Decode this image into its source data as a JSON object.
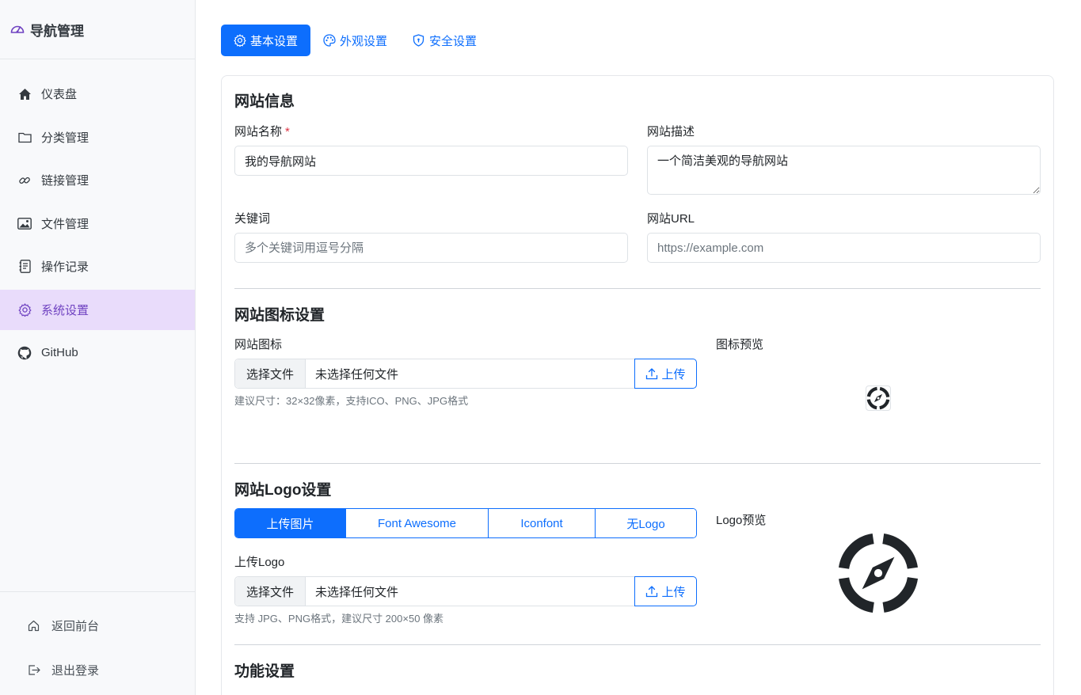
{
  "brand": {
    "title": "导航管理",
    "icon": "gauge-icon"
  },
  "sidebar": {
    "items": [
      {
        "label": "仪表盘",
        "icon": "house-icon"
      },
      {
        "label": "分类管理",
        "icon": "folder-icon"
      },
      {
        "label": "链接管理",
        "icon": "link-icon"
      },
      {
        "label": "文件管理",
        "icon": "image-icon"
      },
      {
        "label": "操作记录",
        "icon": "journal-icon"
      },
      {
        "label": "系统设置",
        "icon": "gear-icon",
        "active": true
      },
      {
        "label": "GitHub",
        "icon": "github-icon"
      }
    ],
    "bottom": [
      {
        "label": "返回前台",
        "icon": "home-outline-icon"
      },
      {
        "label": "退出登录",
        "icon": "logout-icon"
      }
    ]
  },
  "tabs": [
    {
      "label": "基本设置",
      "icon": "gear-icon",
      "active": true
    },
    {
      "label": "外观设置",
      "icon": "palette-icon"
    },
    {
      "label": "安全设置",
      "icon": "shield-icon"
    }
  ],
  "site_info": {
    "title": "网站信息",
    "name_label": "网站名称",
    "name_required": "*",
    "name_value": "我的导航网站",
    "desc_label": "网站描述",
    "desc_value": "一个简洁美观的导航网站",
    "keywords_label": "关键词",
    "keywords_placeholder": "多个关键词用逗号分隔",
    "url_label": "网站URL",
    "url_placeholder": "https://example.com"
  },
  "favicon": {
    "title": "网站图标设置",
    "label": "网站图标",
    "choose_label": "选择文件",
    "file_status": "未选择任何文件",
    "upload_label": "上传",
    "hint": "建议尺寸：32×32像素，支持ICO、PNG、JPG格式",
    "preview_label": "图标预览"
  },
  "logo": {
    "title": "网站Logo设置",
    "modes": [
      "上传图片",
      "Font Awesome",
      "Iconfont",
      "无Logo"
    ],
    "active_mode": 0,
    "upload_label_title": "上传Logo",
    "choose_label": "选择文件",
    "file_status": "未选择任何文件",
    "upload_label": "上传",
    "hint": "支持 JPG、PNG格式，建议尺寸 200×50 像素",
    "preview_label": "Logo预览"
  },
  "features": {
    "title": "功能设置"
  },
  "colors": {
    "primary": "#0d6efd",
    "active_nav_bg": "#e9dcfb",
    "active_nav_text": "#6f42c1"
  }
}
